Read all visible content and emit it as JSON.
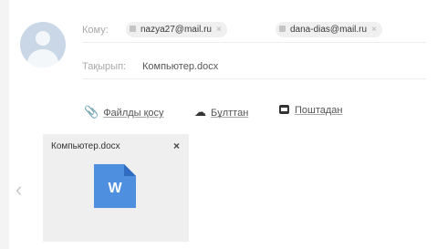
{
  "composer": {
    "to_label": "Кому:",
    "recipients": [
      {
        "email": "nazya27@mail.ru",
        "icon": "contact-icon",
        "close": "×"
      },
      {
        "email": "dana-dias@mail.ru",
        "icon": "contact-icon",
        "close": "×"
      }
    ],
    "subject_label": "Тақырып:",
    "subject_value": "Компьютер.docx"
  },
  "actions": [
    {
      "label": "Файлды қосу",
      "icon": "paperclip-icon",
      "glyph": "🖉"
    },
    {
      "label": "Бұлттан",
      "icon": "cloud-icon",
      "glyph": "☁"
    },
    {
      "label": "Поштадан",
      "icon": "mail-icon",
      "glyph": ""
    }
  ],
  "attachment": {
    "filename": "Компьютер.docx",
    "close": "×",
    "file_letter": "W"
  },
  "nav": {
    "prev": "‹"
  },
  "colors": {
    "doc_blue": "#4f8fe0",
    "chip_bg": "#f0f0f0"
  }
}
